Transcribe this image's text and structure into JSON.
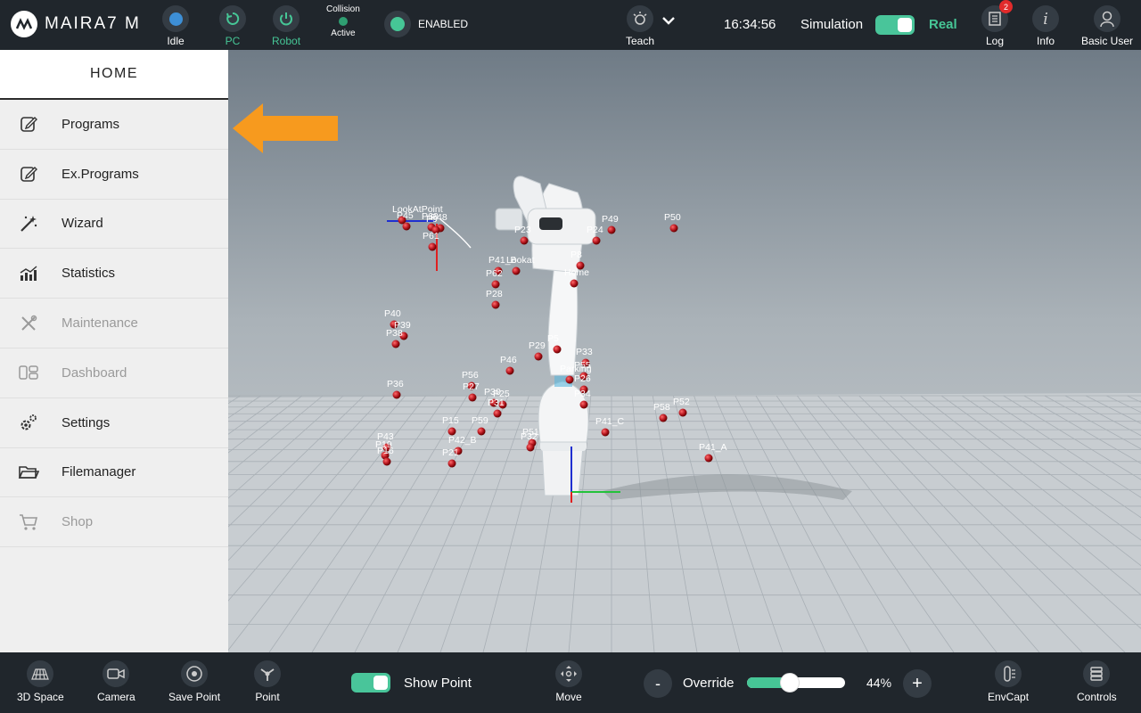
{
  "app": {
    "title": "MAIRA7 M"
  },
  "topbar": {
    "status": [
      {
        "label": "Idle",
        "color": "#3d8fd6"
      },
      {
        "label": "PC",
        "color": "#46c696"
      },
      {
        "label": "Robot",
        "color": "#46c696"
      }
    ],
    "collision": {
      "title": "Collision",
      "state": "Active"
    },
    "enabled_label": "ENABLED",
    "teach_label": "Teach",
    "clock": "16:34:56",
    "simulation_label": "Simulation",
    "real_label": "Real",
    "log": {
      "label": "Log",
      "badge": "2"
    },
    "info_label": "Info",
    "user_label": "Basic User"
  },
  "sidebar": {
    "home_label": "HOME",
    "items": [
      {
        "label": "Programs",
        "icon": "edit-icon",
        "enabled": true
      },
      {
        "label": "Ex.Programs",
        "icon": "edit-icon",
        "enabled": true
      },
      {
        "label": "Wizard",
        "icon": "magic-wand-icon",
        "enabled": true
      },
      {
        "label": "Statistics",
        "icon": "bar-chart-icon",
        "enabled": true
      },
      {
        "label": "Maintenance",
        "icon": "tools-icon",
        "enabled": false
      },
      {
        "label": "Dashboard",
        "icon": "dashboard-icon",
        "enabled": false
      },
      {
        "label": "Settings",
        "icon": "gears-icon",
        "enabled": true
      },
      {
        "label": "Filemanager",
        "icon": "folder-icon",
        "enabled": true
      },
      {
        "label": "Shop",
        "icon": "cart-icon",
        "enabled": false
      }
    ]
  },
  "viewport": {
    "points": [
      "LookAtPoint",
      "P45",
      "P60",
      "P48",
      "P9",
      "P61",
      "P23",
      "P24",
      "P49",
      "P50",
      "P41_B",
      "Lookat",
      "P8",
      "Home",
      "P62",
      "P28",
      "P40",
      "P39",
      "P38",
      "P29",
      "P5",
      "P33",
      "P46",
      "P55",
      "Parking",
      "P26",
      "P56",
      "P27",
      "P36",
      "P30",
      "P25",
      "P31",
      "P34",
      "P59",
      "P15",
      "P41_C",
      "P58",
      "P52",
      "P51",
      "P32",
      "P42_B",
      "P41_A",
      "P43",
      "P19",
      "P16",
      "P21"
    ]
  },
  "bottombar": {
    "space_label": "3D Space",
    "camera_label": "Camera",
    "save_point_label": "Save Point",
    "point_label": "Point",
    "show_point_label": "Show Point",
    "move_label": "Move",
    "minus": "-",
    "override_label": "Override",
    "override_value": "44%",
    "override_fraction": 0.44,
    "plus": "+",
    "envcapt_label": "EnvCapt",
    "controls_label": "Controls"
  },
  "colors": {
    "accent": "#46c696",
    "highlight_arrow": "#f79a1e",
    "point": "#c41e2a"
  }
}
